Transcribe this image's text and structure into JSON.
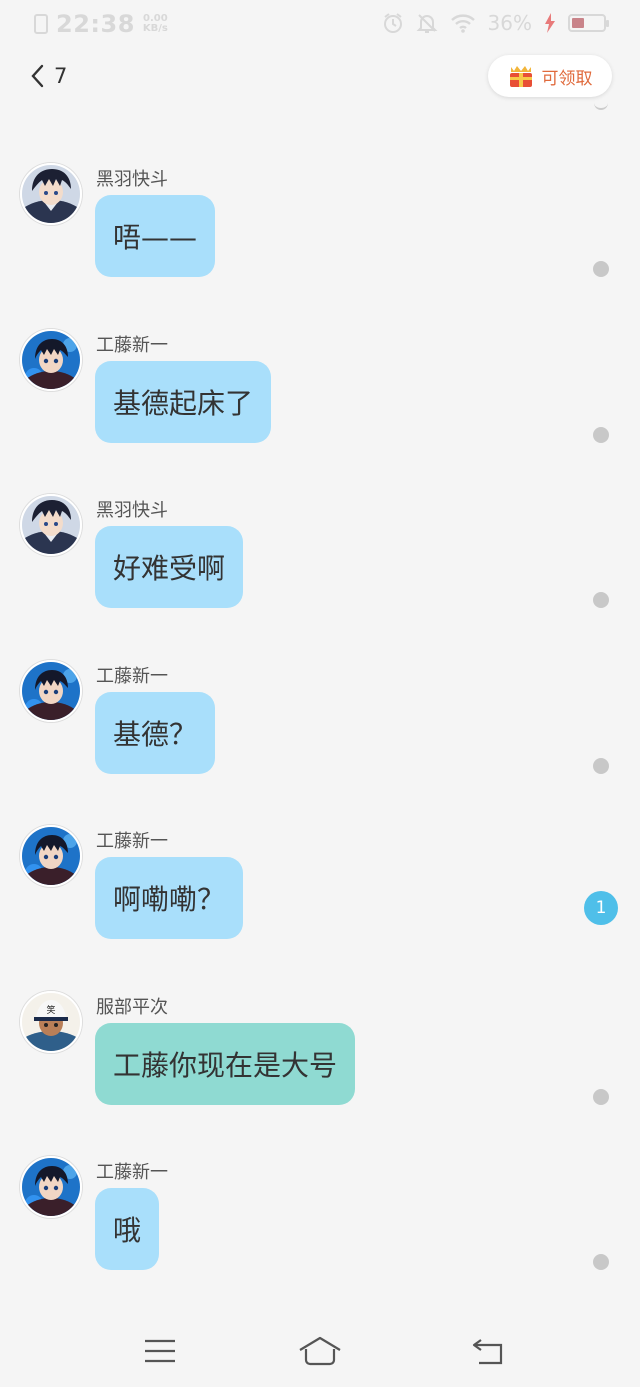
{
  "status_bar": {
    "time": "22:38",
    "net_speed_value": "0.00",
    "net_speed_unit": "KB/s",
    "battery_percent": "36%",
    "icons": [
      "sim-icon",
      "alarm-icon",
      "mute-icon",
      "wifi-icon",
      "charging-icon",
      "battery-icon"
    ]
  },
  "header": {
    "back_count": "7",
    "claim_label": "可领取",
    "claim_icon": "gift-box-icon"
  },
  "colors": {
    "bubble_default": "#a9dffb",
    "bubble_teal": "#8fdad2",
    "badge": "#4fbfe9",
    "claim_text": "#e06a3c"
  },
  "messages": [
    {
      "sender": "黑羽快斗",
      "text": "唔——",
      "avatar": "kaito",
      "status": "dot"
    },
    {
      "sender": "工藤新一",
      "text": "基德起床了",
      "avatar": "shinichi",
      "status": "dot"
    },
    {
      "sender": "黑羽快斗",
      "text": "好难受啊",
      "avatar": "kaito",
      "status": "dot"
    },
    {
      "sender": "工藤新一",
      "text": "基德？",
      "avatar": "shinichi",
      "status": "dot"
    },
    {
      "sender": "工藤新一",
      "text": "啊嘞嘞？",
      "avatar": "shinichi",
      "status": "badge",
      "badge": "1"
    },
    {
      "sender": "服部平次",
      "text": "工藤你现在是大号",
      "avatar": "heiji",
      "status": "dot",
      "bubble": "teal"
    },
    {
      "sender": "工藤新一",
      "text": "哦",
      "avatar": "shinichi",
      "status": "dot"
    }
  ],
  "navbar": {
    "icons": [
      "menu-icon",
      "home-icon",
      "back-icon"
    ]
  }
}
